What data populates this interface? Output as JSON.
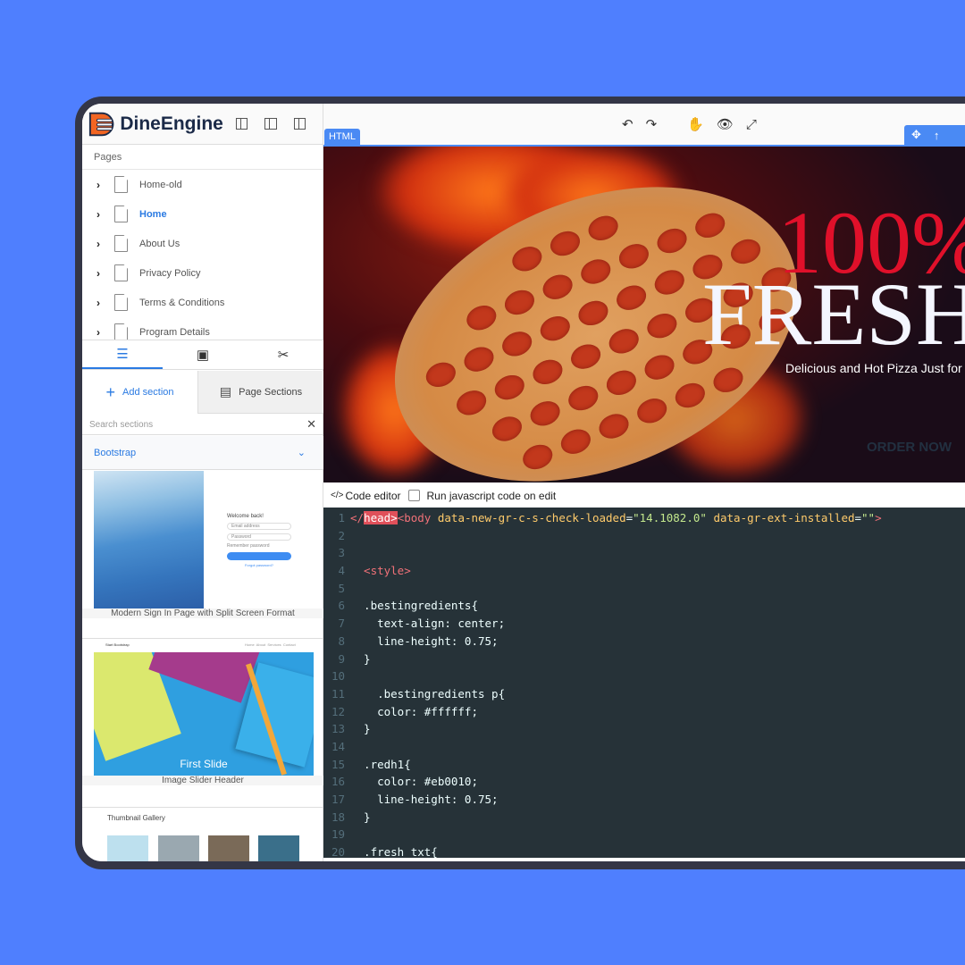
{
  "brand": {
    "name": "DineEngine",
    "accent": "#2a7ae2",
    "logo_color": "#f26522"
  },
  "sidebar": {
    "pages_label": "Pages",
    "pages": [
      {
        "label": "Home-old"
      },
      {
        "label": "Home",
        "active": true
      },
      {
        "label": "About Us"
      },
      {
        "label": "Privacy Policy"
      },
      {
        "label": "Terms & Conditions"
      },
      {
        "label": "Program Details"
      }
    ],
    "tabs": [
      {
        "icon": "sections-icon",
        "active": true
      },
      {
        "icon": "box-icon"
      },
      {
        "icon": "tools-icon"
      }
    ],
    "add_section": "Add section",
    "page_sections": "Page Sections",
    "search_placeholder": "Search sections",
    "category": "Bootstrap",
    "thumbnails": [
      {
        "caption": "Modern Sign In Page with Split Screen Format",
        "welcome": "Welcome back!",
        "email": "Email address",
        "password": "Password",
        "remember": "Remember password",
        "signin": "SIGN IN",
        "forgot": "Forgot password?"
      },
      {
        "caption": "Image Slider Header",
        "brand": "Start Bootstrap",
        "nav": "Home  About  Services  Contact",
        "slide_title": "First Slide"
      },
      {
        "title": "Thumbnail Gallery"
      }
    ]
  },
  "toolbar": {
    "icons": [
      "undo-icon",
      "redo-icon",
      "hand-icon",
      "eye-icon",
      "fullscreen-icon"
    ],
    "element_tag": "HTML"
  },
  "hero": {
    "line1": "100%",
    "line2": "FRESH",
    "subtitle": "Delicious and Hot Pizza Just for",
    "cta": "ORDER NOW"
  },
  "editor": {
    "title": "Code editor",
    "run_js_label": "Run javascript code on edit",
    "run_js_checked": false,
    "lines": [
      "</head><body data-new-gr-c-s-check-loaded=\"14.1082.0\" data-gr-ext-installed=\"\">",
      "",
      "",
      "  <style>",
      "",
      "  .bestingredients{",
      "    text-align: center;",
      "    line-height: 0.75;",
      "  }",
      "",
      "    .bestingredients p{",
      "    color: #ffffff;",
      "  }",
      "",
      "  .redh1{",
      "    color: #eb0010;",
      "    line-height: 0.75;",
      "  }",
      "",
      "  .fresh_txt{"
    ]
  }
}
